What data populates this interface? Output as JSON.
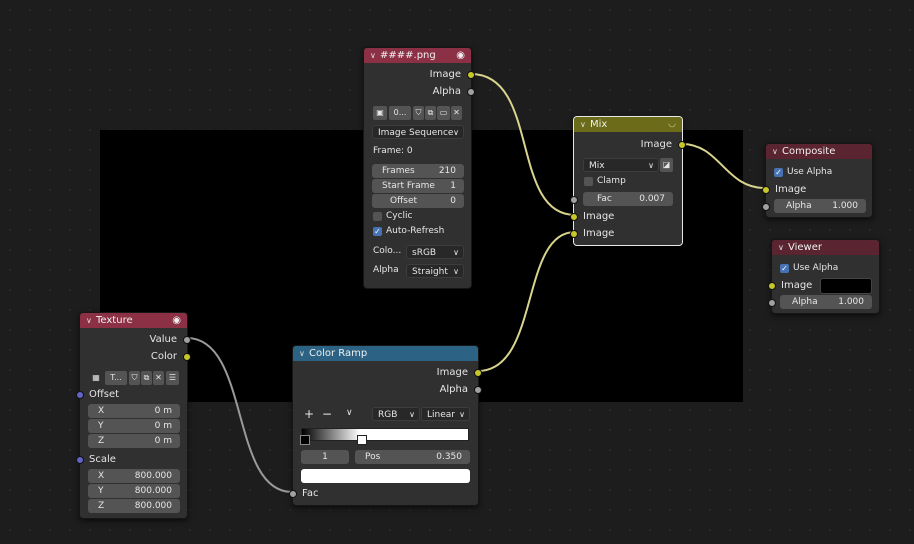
{
  "nodes": {
    "image": {
      "title": "####.png",
      "out_image": "Image",
      "out_alpha": "Alpha",
      "image_name": "0...",
      "source": "Image Sequence",
      "frame_label": "Frame: 0",
      "frames_label": "Frames",
      "frames_value": "210",
      "start_label": "Start Frame",
      "start_value": "1",
      "offset_label": "Offset",
      "offset_value": "0",
      "cyclic": "Cyclic",
      "auto_refresh": "Auto-Refresh",
      "colorspace_label": "Colo...",
      "colorspace_value": "sRGB",
      "alpha_label": "Alpha",
      "alpha_value": "Straight"
    },
    "mix": {
      "title": "Mix",
      "out_image": "Image",
      "blend_mode": "Mix",
      "clamp": "Clamp",
      "fac_label": "Fac",
      "fac_value": "0.007",
      "in_image1": "Image",
      "in_image2": "Image"
    },
    "composite": {
      "title": "Composite",
      "use_alpha": "Use Alpha",
      "in_image": "Image",
      "alpha_label": "Alpha",
      "alpha_value": "1.000"
    },
    "viewer": {
      "title": "Viewer",
      "use_alpha": "Use Alpha",
      "in_image": "Image",
      "alpha_label": "Alpha",
      "alpha_value": "1.000"
    },
    "texture": {
      "title": "Texture",
      "out_value": "Value",
      "out_color": "Color",
      "tex_name": "T...",
      "offset_label": "Offset",
      "ox_label": "X",
      "ox_value": "0 m",
      "oy_label": "Y",
      "oy_value": "0 m",
      "oz_label": "Z",
      "oz_value": "0 m",
      "scale_label": "Scale",
      "sx_label": "X",
      "sx_value": "800.000",
      "sy_label": "Y",
      "sy_value": "800.000",
      "sz_label": "Z",
      "sz_value": "800.000"
    },
    "colorramp": {
      "title": "Color Ramp",
      "out_image": "Image",
      "out_alpha": "Alpha",
      "add": "+",
      "remove": "−",
      "menu": "∨",
      "color_mode": "RGB",
      "interpolation": "Linear",
      "stop_index": "1",
      "pos_label": "Pos",
      "pos_value": "0.350",
      "in_fac": "Fac"
    }
  },
  "colors": {
    "image_header": "#8c3045",
    "mix_header": "#6b6b1a",
    "output_header": "#5a2530",
    "colorramp_header": "#2c6385",
    "socket_color": "#c7c729",
    "socket_float": "#a1a1a1",
    "socket_vector": "#6363c7",
    "link": "#d8d48e",
    "link_gray": "#9a9a9a"
  }
}
